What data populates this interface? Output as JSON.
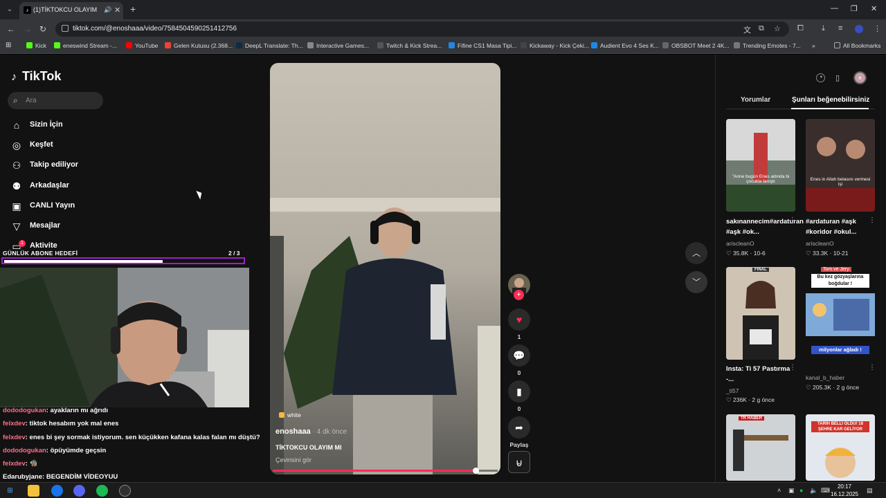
{
  "browser": {
    "tab_title": "(1)TİKTOKCU OLAYIM MI |",
    "url": "tiktok.com/@enoshaaa/video/7584504590251412756",
    "bookmarks": [
      "Kick",
      "eneswind Stream -...",
      "YouTube",
      "Gelen Kutusu (2.368...",
      "DeepL Translate: Th...",
      "Interactive Games...",
      "Twitch & Kick Strea...",
      "Fifine CS1 Masa Tipi...",
      "Kickaway - Kick Çeki...",
      "Audient Evo 4 Ses K...",
      "OBSBOT Meet 2 4K...",
      "Trending Emotes - 7..."
    ],
    "all_bookmarks": "All Bookmarks"
  },
  "tiktok": {
    "logo": "TikTok",
    "search_placeholder": "Ara",
    "nav": [
      {
        "label": "Sizin İçin",
        "icon": "home-icon"
      },
      {
        "label": "Keşfet",
        "icon": "compass-icon"
      },
      {
        "label": "Takip ediliyor",
        "icon": "following-icon"
      },
      {
        "label": "Arkadaşlar",
        "icon": "friends-icon"
      },
      {
        "label": "CANLI Yayın",
        "icon": "live-icon"
      },
      {
        "label": "Mesajlar",
        "icon": "messages-icon"
      },
      {
        "label": "Aktivite",
        "icon": "activity-icon"
      }
    ],
    "notif_count": "1"
  },
  "stream_overlay": {
    "goal_label": "GÜNLÜK ABONE HEDEFİ",
    "goal_count": "2 / 3",
    "goal_progress": 0.667,
    "chat": [
      {
        "user": "dododogukan",
        "text": ": ayakların mı ağrıdı"
      },
      {
        "user": "felxdev",
        "text": ": tiktok hesabım yok mal enes"
      },
      {
        "user": "felxdev",
        "text": ": enes bi şey sormak istiyorum. sen küçükken kafana kalas falan mı düştü?"
      },
      {
        "user": "dododogukan",
        "text": ": öpüyümde geçsin"
      },
      {
        "user": "felxdev",
        "text": ": 🧌"
      },
      {
        "user": "Edarubyjane",
        "text": ": BEGENDİM VİDEOYUU"
      }
    ]
  },
  "video": {
    "tag": "white",
    "author": "enoshaaa",
    "time": " · 4 dk önce",
    "caption": "TİKTOKCU OLAYIM MI",
    "translate": "Çevirisini gör",
    "progress": 0.9
  },
  "actions": {
    "likes": "1",
    "comments": "0",
    "saves": "0",
    "share_label": "Paylaş"
  },
  "right_panel": {
    "tabs": [
      "Yorumlar",
      "Şunları beğenebilirsiniz"
    ],
    "videos": [
      {
        "title": "sakınannecim#ardaturan #aşk #ok...",
        "author": "ariscleanO",
        "likes": "35.8K",
        "date": "10-6",
        "overlay": "\"Anne bugün Enes adında bi çocukla tanıştı"
      },
      {
        "title": "#ardaturan #aşk #koridor #okul...",
        "author": "ariscleanO",
        "likes": "33.3K",
        "date": "10-21",
        "overlay": "Enes in Allah belasını vermesi işi"
      },
      {
        "title": "Insta: Ti 57 Pastırma -...",
        "author": "_ti57",
        "likes": "236K",
        "date": "2 g önce",
        "overlay": "FİNAL"
      },
      {
        "title": "",
        "author": "kanal_b_haber",
        "likes": "205.3K",
        "date": "2 g önce",
        "overlay": "Tom ve Jery",
        "overlay2": "Bu kez gözyaşlarına boğdular !",
        "overlay3": "milyonlar ağladı !"
      },
      {
        "title": "",
        "author": "",
        "likes": "",
        "date": "",
        "overlay": "TR HABER"
      },
      {
        "title": "",
        "author": "",
        "likes": "",
        "date": "",
        "overlay": "TARİH BELLİ OLDU! 18 ŞEHRE KAR GELİYOR"
      }
    ]
  },
  "taskbar": {
    "time": "20:17",
    "date": "16.12.2025"
  }
}
